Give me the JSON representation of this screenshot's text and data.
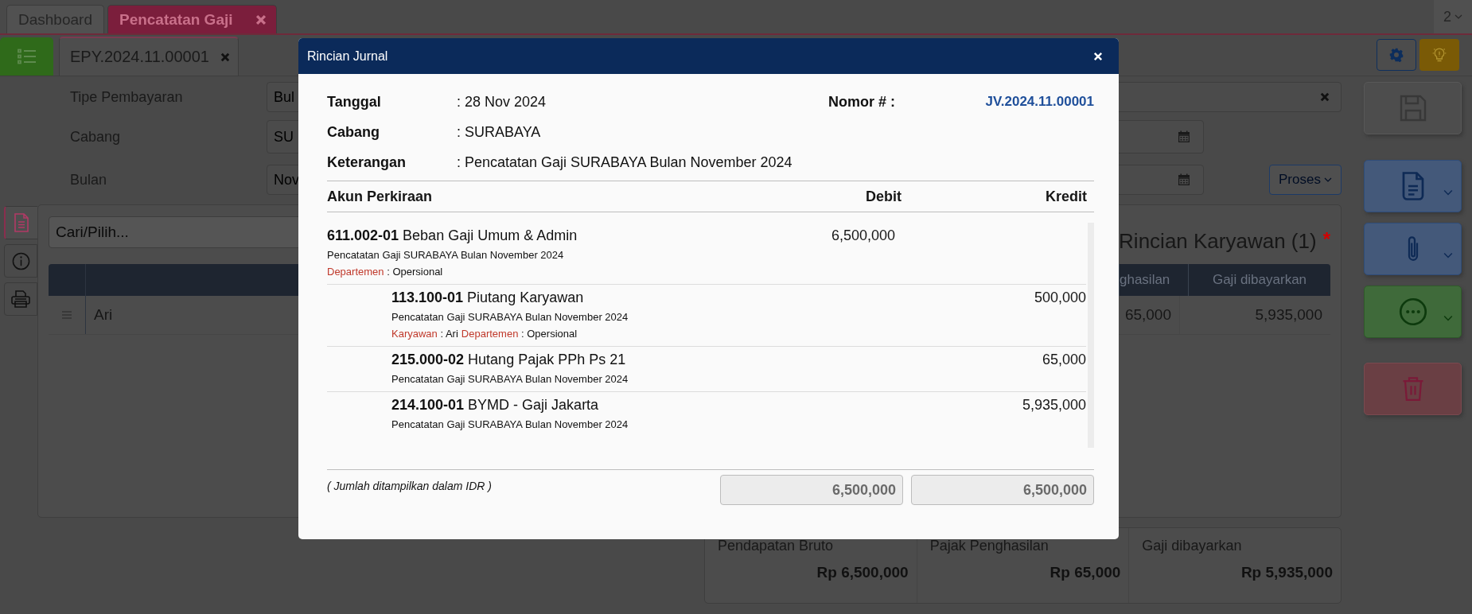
{
  "top_tabs": [
    {
      "label": "Dashboard",
      "selected": false,
      "closable": false
    },
    {
      "label": "Pencatatan Gaji",
      "selected": true,
      "closable": true
    }
  ],
  "page_selector": "2",
  "doc_tab": {
    "label": "EPY.2024.11.00001"
  },
  "form": [
    {
      "label": "Tipe Pembayaran",
      "value": "Bul",
      "kind": "clearable"
    },
    {
      "label": "Cabang",
      "value": "SU",
      "kind": "date"
    },
    {
      "label": "Bulan",
      "value": "Nov",
      "kind": "date"
    }
  ],
  "process_button": "Proses",
  "side_tabs": [
    {
      "kind": "document",
      "selected": true
    },
    {
      "kind": "info",
      "selected": false
    },
    {
      "kind": "print",
      "selected": false
    }
  ],
  "search": {
    "placeholder": "Cari/Pilih..."
  },
  "employees": {
    "title": "Rincian Karyawan (1)",
    "required_mark": "*",
    "columns": [
      "ghasilan",
      "Gaji dibayarkan"
    ],
    "rows": [
      {
        "name": "Ari",
        "cells": [
          "65,000",
          "5,935,000"
        ]
      }
    ]
  },
  "summary": [
    {
      "label": "Pendapatan Bruto",
      "value": "Rp 6,500,000"
    },
    {
      "label": "Pajak Penghasilan",
      "value": "Rp 65,000"
    },
    {
      "label": "Gaji dibayarkan",
      "value": "Rp 5,935,000"
    }
  ],
  "actions": [
    {
      "kind": "save"
    },
    {
      "kind": "document"
    },
    {
      "kind": "attach"
    },
    {
      "kind": "more"
    },
    {
      "kind": "delete"
    }
  ],
  "modal": {
    "title": "Rincian Jurnal",
    "fields": [
      {
        "label": "Tanggal",
        "value": ": 28 Nov 2024"
      },
      {
        "label": "Cabang",
        "value": ": SURABAYA"
      },
      {
        "label": "Keterangan",
        "value": ": Pencatatan Gaji SURABAYA Bulan November 2024"
      }
    ],
    "number": {
      "label": "Nomor # :",
      "value": "JV.2024.11.00001"
    },
    "columns": [
      "Akun Perkiraan",
      "Debit",
      "Kredit"
    ],
    "entries": [
      {
        "code": "611.002-01",
        "name": "Beban Gaji Umum & Admin",
        "description": "Pencatatan Gaji SURABAYA Bulan November 2024",
        "debit": "6,500,000",
        "meta": [
          {
            "key": "Departemen",
            "value": ": Opersional"
          }
        ]
      },
      {
        "code": "113.100-01",
        "name": "Piutang Karyawan",
        "description": "Pencatatan Gaji SURABAYA Bulan November 2024",
        "credit": "500,000",
        "meta": [
          {
            "key": "Karyawan",
            "value": ": Ari"
          },
          {
            "key": "Departemen",
            "value": ": Opersional"
          }
        ]
      },
      {
        "code": "215.000-02",
        "name": "Hutang Pajak PPh Ps 21",
        "description": "Pencatatan Gaji SURABAYA Bulan November 2024",
        "credit": "65,000"
      },
      {
        "code": "214.100-01",
        "name": "BYMD - Gaji Jakarta",
        "description": "Pencatatan Gaji SURABAYA Bulan November 2024",
        "credit": "5,935,000"
      }
    ],
    "note": "( Jumlah ditampilkan dalam IDR )",
    "totals": [
      "6,500,000",
      "6,500,000"
    ]
  }
}
